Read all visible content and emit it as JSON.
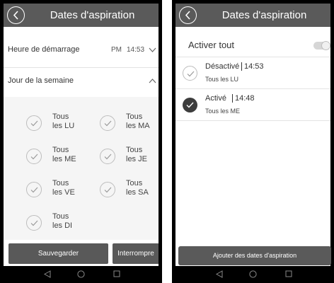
{
  "left_screen": {
    "title": "Dates d'aspiration",
    "start_time": {
      "label": "Heure de démarrage",
      "period": "PM",
      "time": "14:53"
    },
    "weekday_section": {
      "label": "Jour de la semaine"
    },
    "days": [
      {
        "line1": "Tous",
        "line2": "les LU"
      },
      {
        "line1": "Tous",
        "line2": "les MA"
      },
      {
        "line1": "Tous",
        "line2": "les ME"
      },
      {
        "line1": "Tous",
        "line2": "les JE"
      },
      {
        "line1": "Tous",
        "line2": "les VE"
      },
      {
        "line1": "Tous",
        "line2": "les SA"
      },
      {
        "line1": "Tous",
        "line2": "les DI"
      }
    ],
    "save_label": "Sauvegarder",
    "cancel_label": "Interrompre"
  },
  "right_screen": {
    "title": "Dates d'aspiration",
    "activate_all_label": "Activer tout",
    "activate_all_on": false,
    "entries": [
      {
        "status": "Désactivé",
        "time": "14:53",
        "days": "Tous les LU",
        "active": false
      },
      {
        "status": "Activé",
        "time": "14:48",
        "days": "Tous les ME",
        "active": true
      }
    ],
    "add_label": "Ajouter des dates d'aspiration"
  },
  "colors": {
    "title_bar": "#5a5a5a",
    "button": "#595959",
    "grid_background": "#f5f5f5",
    "active_check": "#3d3d3d"
  },
  "icons": [
    "back-arrow-icon",
    "chevron-down-icon",
    "chevron-up-icon",
    "check-circle-icon",
    "nav-back-icon",
    "nav-home-icon",
    "nav-recents-icon"
  ]
}
